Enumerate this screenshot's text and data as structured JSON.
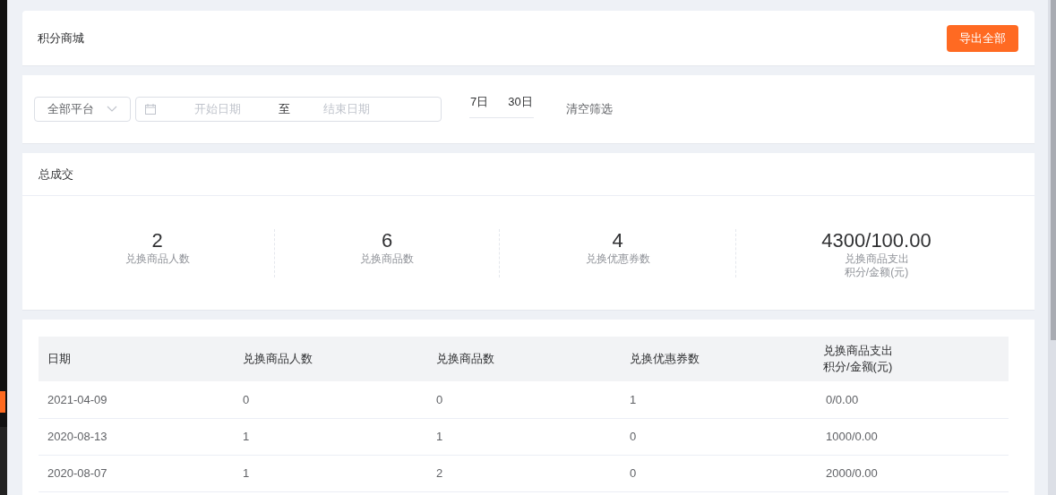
{
  "header": {
    "title": "积分商城",
    "export_button": "导出全部"
  },
  "filters": {
    "platform": "全部平台",
    "start_placeholder": "开始日期",
    "separator": "至",
    "end_placeholder": "结束日期",
    "quick_ranges": [
      {
        "label": "7日",
        "selected": false
      },
      {
        "label": "30日",
        "selected": false
      }
    ],
    "clear": "清空筛选"
  },
  "summary": {
    "title": "总成交",
    "stats": [
      {
        "value": "2",
        "label": "兑换商品人数"
      },
      {
        "value": "6",
        "label": "兑换商品数"
      },
      {
        "value": "4",
        "label": "兑换优惠券数"
      },
      {
        "value": "4300/100.00",
        "label": "兑换商品支出",
        "sublabel": "积分/金额(元)"
      }
    ]
  },
  "table": {
    "columns": [
      {
        "label": "日期"
      },
      {
        "label": "兑换商品人数"
      },
      {
        "label": "兑换商品数"
      },
      {
        "label": "兑换优惠券数"
      },
      {
        "label": "兑换商品支出",
        "sublabel": "积分/金额(元)"
      }
    ],
    "rows": [
      [
        "2021-04-09",
        "0",
        "0",
        "1",
        "0/0.00"
      ],
      [
        "2020-08-13",
        "1",
        "1",
        "0",
        "1000/0.00"
      ],
      [
        "2020-08-07",
        "1",
        "2",
        "0",
        "2000/0.00"
      ]
    ]
  }
}
